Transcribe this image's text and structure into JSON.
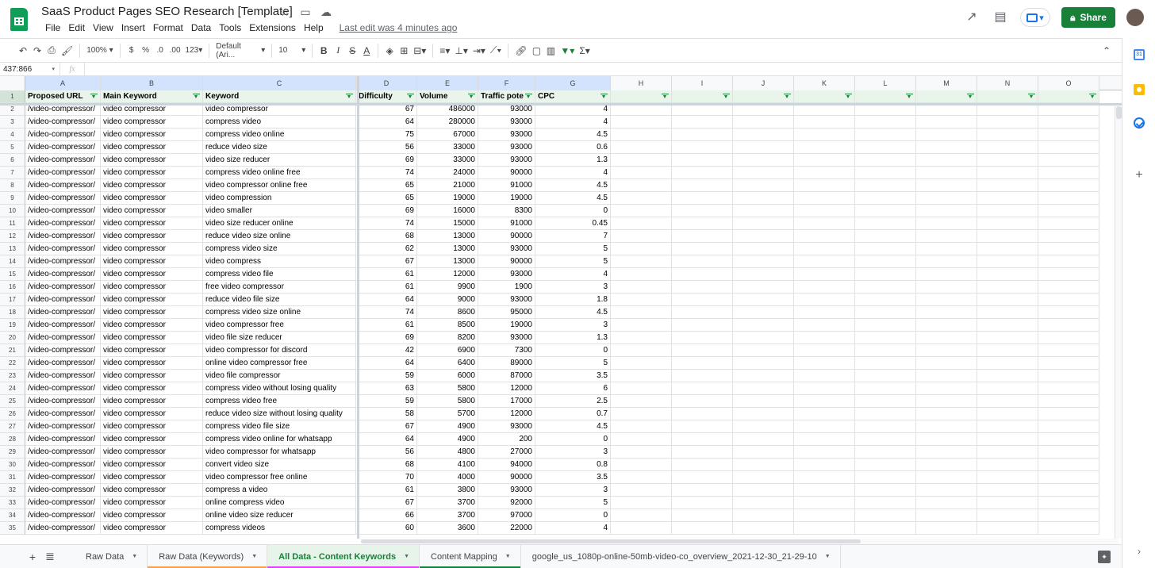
{
  "title": "SaaS Product Pages SEO Research [Template]",
  "menus": [
    "File",
    "Edit",
    "View",
    "Insert",
    "Format",
    "Data",
    "Tools",
    "Extensions",
    "Help"
  ],
  "last_edit": "Last edit was 4 minutes ago",
  "share_label": "Share",
  "toolbar": {
    "zoom": "100%",
    "currency": "$",
    "percent": "%",
    "dec_decrease": ".0",
    "dec_increase": ".00",
    "number_format": "123",
    "font": "Default (Ari...",
    "font_size": "10"
  },
  "name_box": "437:866",
  "fx_label": "fx",
  "columns": [
    "A",
    "B",
    "C",
    "D",
    "E",
    "F",
    "G",
    "H",
    "I",
    "J",
    "K",
    "L",
    "M",
    "N",
    "O"
  ],
  "headers": [
    "Proposed URL",
    "Main Keyword",
    "Keyword",
    "Difficulty",
    "Volume",
    "Traffic pote",
    "CPC",
    "",
    "",
    "",
    "",
    "",
    "",
    "",
    ""
  ],
  "rows": [
    [
      "/video-compressor/",
      "video compressor",
      "video compressor",
      "67",
      "486000",
      "93000",
      "4"
    ],
    [
      "/video-compressor/",
      "video compressor",
      "compress video",
      "64",
      "280000",
      "93000",
      "4"
    ],
    [
      "/video-compressor/",
      "video compressor",
      "compress video online",
      "75",
      "67000",
      "93000",
      "4.5"
    ],
    [
      "/video-compressor/",
      "video compressor",
      "reduce video size",
      "56",
      "33000",
      "93000",
      "0.6"
    ],
    [
      "/video-compressor/",
      "video compressor",
      "video size reducer",
      "69",
      "33000",
      "93000",
      "1.3"
    ],
    [
      "/video-compressor/",
      "video compressor",
      "compress video online free",
      "74",
      "24000",
      "90000",
      "4"
    ],
    [
      "/video-compressor/",
      "video compressor",
      "video compressor online free",
      "65",
      "21000",
      "91000",
      "4.5"
    ],
    [
      "/video-compressor/",
      "video compressor",
      "video compression",
      "65",
      "19000",
      "19000",
      "4.5"
    ],
    [
      "/video-compressor/",
      "video compressor",
      "video smaller",
      "69",
      "16000",
      "8300",
      "0"
    ],
    [
      "/video-compressor/",
      "video compressor",
      "video size reducer online",
      "74",
      "15000",
      "91000",
      "0.45"
    ],
    [
      "/video-compressor/",
      "video compressor",
      "reduce video size online",
      "68",
      "13000",
      "90000",
      "7"
    ],
    [
      "/video-compressor/",
      "video compressor",
      "compress video size",
      "62",
      "13000",
      "93000",
      "5"
    ],
    [
      "/video-compressor/",
      "video compressor",
      "video compress",
      "67",
      "13000",
      "90000",
      "5"
    ],
    [
      "/video-compressor/",
      "video compressor",
      "compress video file",
      "61",
      "12000",
      "93000",
      "4"
    ],
    [
      "/video-compressor/",
      "video compressor",
      "free video compressor",
      "61",
      "9900",
      "1900",
      "3"
    ],
    [
      "/video-compressor/",
      "video compressor",
      "reduce video file size",
      "64",
      "9000",
      "93000",
      "1.8"
    ],
    [
      "/video-compressor/",
      "video compressor",
      "compress video size online",
      "74",
      "8600",
      "95000",
      "4.5"
    ],
    [
      "/video-compressor/",
      "video compressor",
      "video compressor free",
      "61",
      "8500",
      "19000",
      "3"
    ],
    [
      "/video-compressor/",
      "video compressor",
      "video file size reducer",
      "69",
      "8200",
      "93000",
      "1.3"
    ],
    [
      "/video-compressor/",
      "video compressor",
      "video compressor for discord",
      "42",
      "6900",
      "7300",
      "0"
    ],
    [
      "/video-compressor/",
      "video compressor",
      "online video compressor free",
      "64",
      "6400",
      "89000",
      "5"
    ],
    [
      "/video-compressor/",
      "video compressor",
      "video file compressor",
      "59",
      "6000",
      "87000",
      "3.5"
    ],
    [
      "/video-compressor/",
      "video compressor",
      "compress video without losing quality",
      "63",
      "5800",
      "12000",
      "6"
    ],
    [
      "/video-compressor/",
      "video compressor",
      "compress video free",
      "59",
      "5800",
      "17000",
      "2.5"
    ],
    [
      "/video-compressor/",
      "video compressor",
      "reduce video size without losing quality",
      "58",
      "5700",
      "12000",
      "0.7"
    ],
    [
      "/video-compressor/",
      "video compressor",
      "compress video file size",
      "67",
      "4900",
      "93000",
      "4.5"
    ],
    [
      "/video-compressor/",
      "video compressor",
      "compress video online for whatsapp",
      "64",
      "4900",
      "200",
      "0"
    ],
    [
      "/video-compressor/",
      "video compressor",
      "video compressor for whatsapp",
      "56",
      "4800",
      "27000",
      "3"
    ],
    [
      "/video-compressor/",
      "video compressor",
      "convert video size",
      "68",
      "4100",
      "94000",
      "0.8"
    ],
    [
      "/video-compressor/",
      "video compressor",
      "video compressor free online",
      "70",
      "4000",
      "90000",
      "3.5"
    ],
    [
      "/video-compressor/",
      "video compressor",
      "compress a video",
      "61",
      "3800",
      "93000",
      "3"
    ],
    [
      "/video-compressor/",
      "video compressor",
      "online compress video",
      "67",
      "3700",
      "92000",
      "5"
    ],
    [
      "/video-compressor/",
      "video compressor",
      "online video size reducer",
      "66",
      "3700",
      "97000",
      "0"
    ],
    [
      "/video-compressor/",
      "video compressor",
      "compress videos",
      "60",
      "3600",
      "22000",
      "4"
    ]
  ],
  "sheet_tabs": [
    {
      "label": "Raw Data",
      "color": "",
      "active": false
    },
    {
      "label": "Raw Data (Keywords)",
      "color": "#f6a04d",
      "active": false
    },
    {
      "label": "All Data - Content Keywords",
      "color": "#e040fb",
      "active": true
    },
    {
      "label": "Content Mapping",
      "color": "#188038",
      "active": false
    },
    {
      "label": "google_us_1080p-online-50mb-video-co_overview_2021-12-30_21-29-10",
      "color": "",
      "active": false
    }
  ],
  "colors": {
    "accent": "#188038",
    "header_fill": "#e9f4eb"
  },
  "icons": [
    "trend-icon",
    "comment-icon",
    "present-icon",
    "lock-icon",
    "calendar-icon",
    "keep-icon",
    "tasks-icon",
    "add-icon",
    "explore-icon"
  ]
}
